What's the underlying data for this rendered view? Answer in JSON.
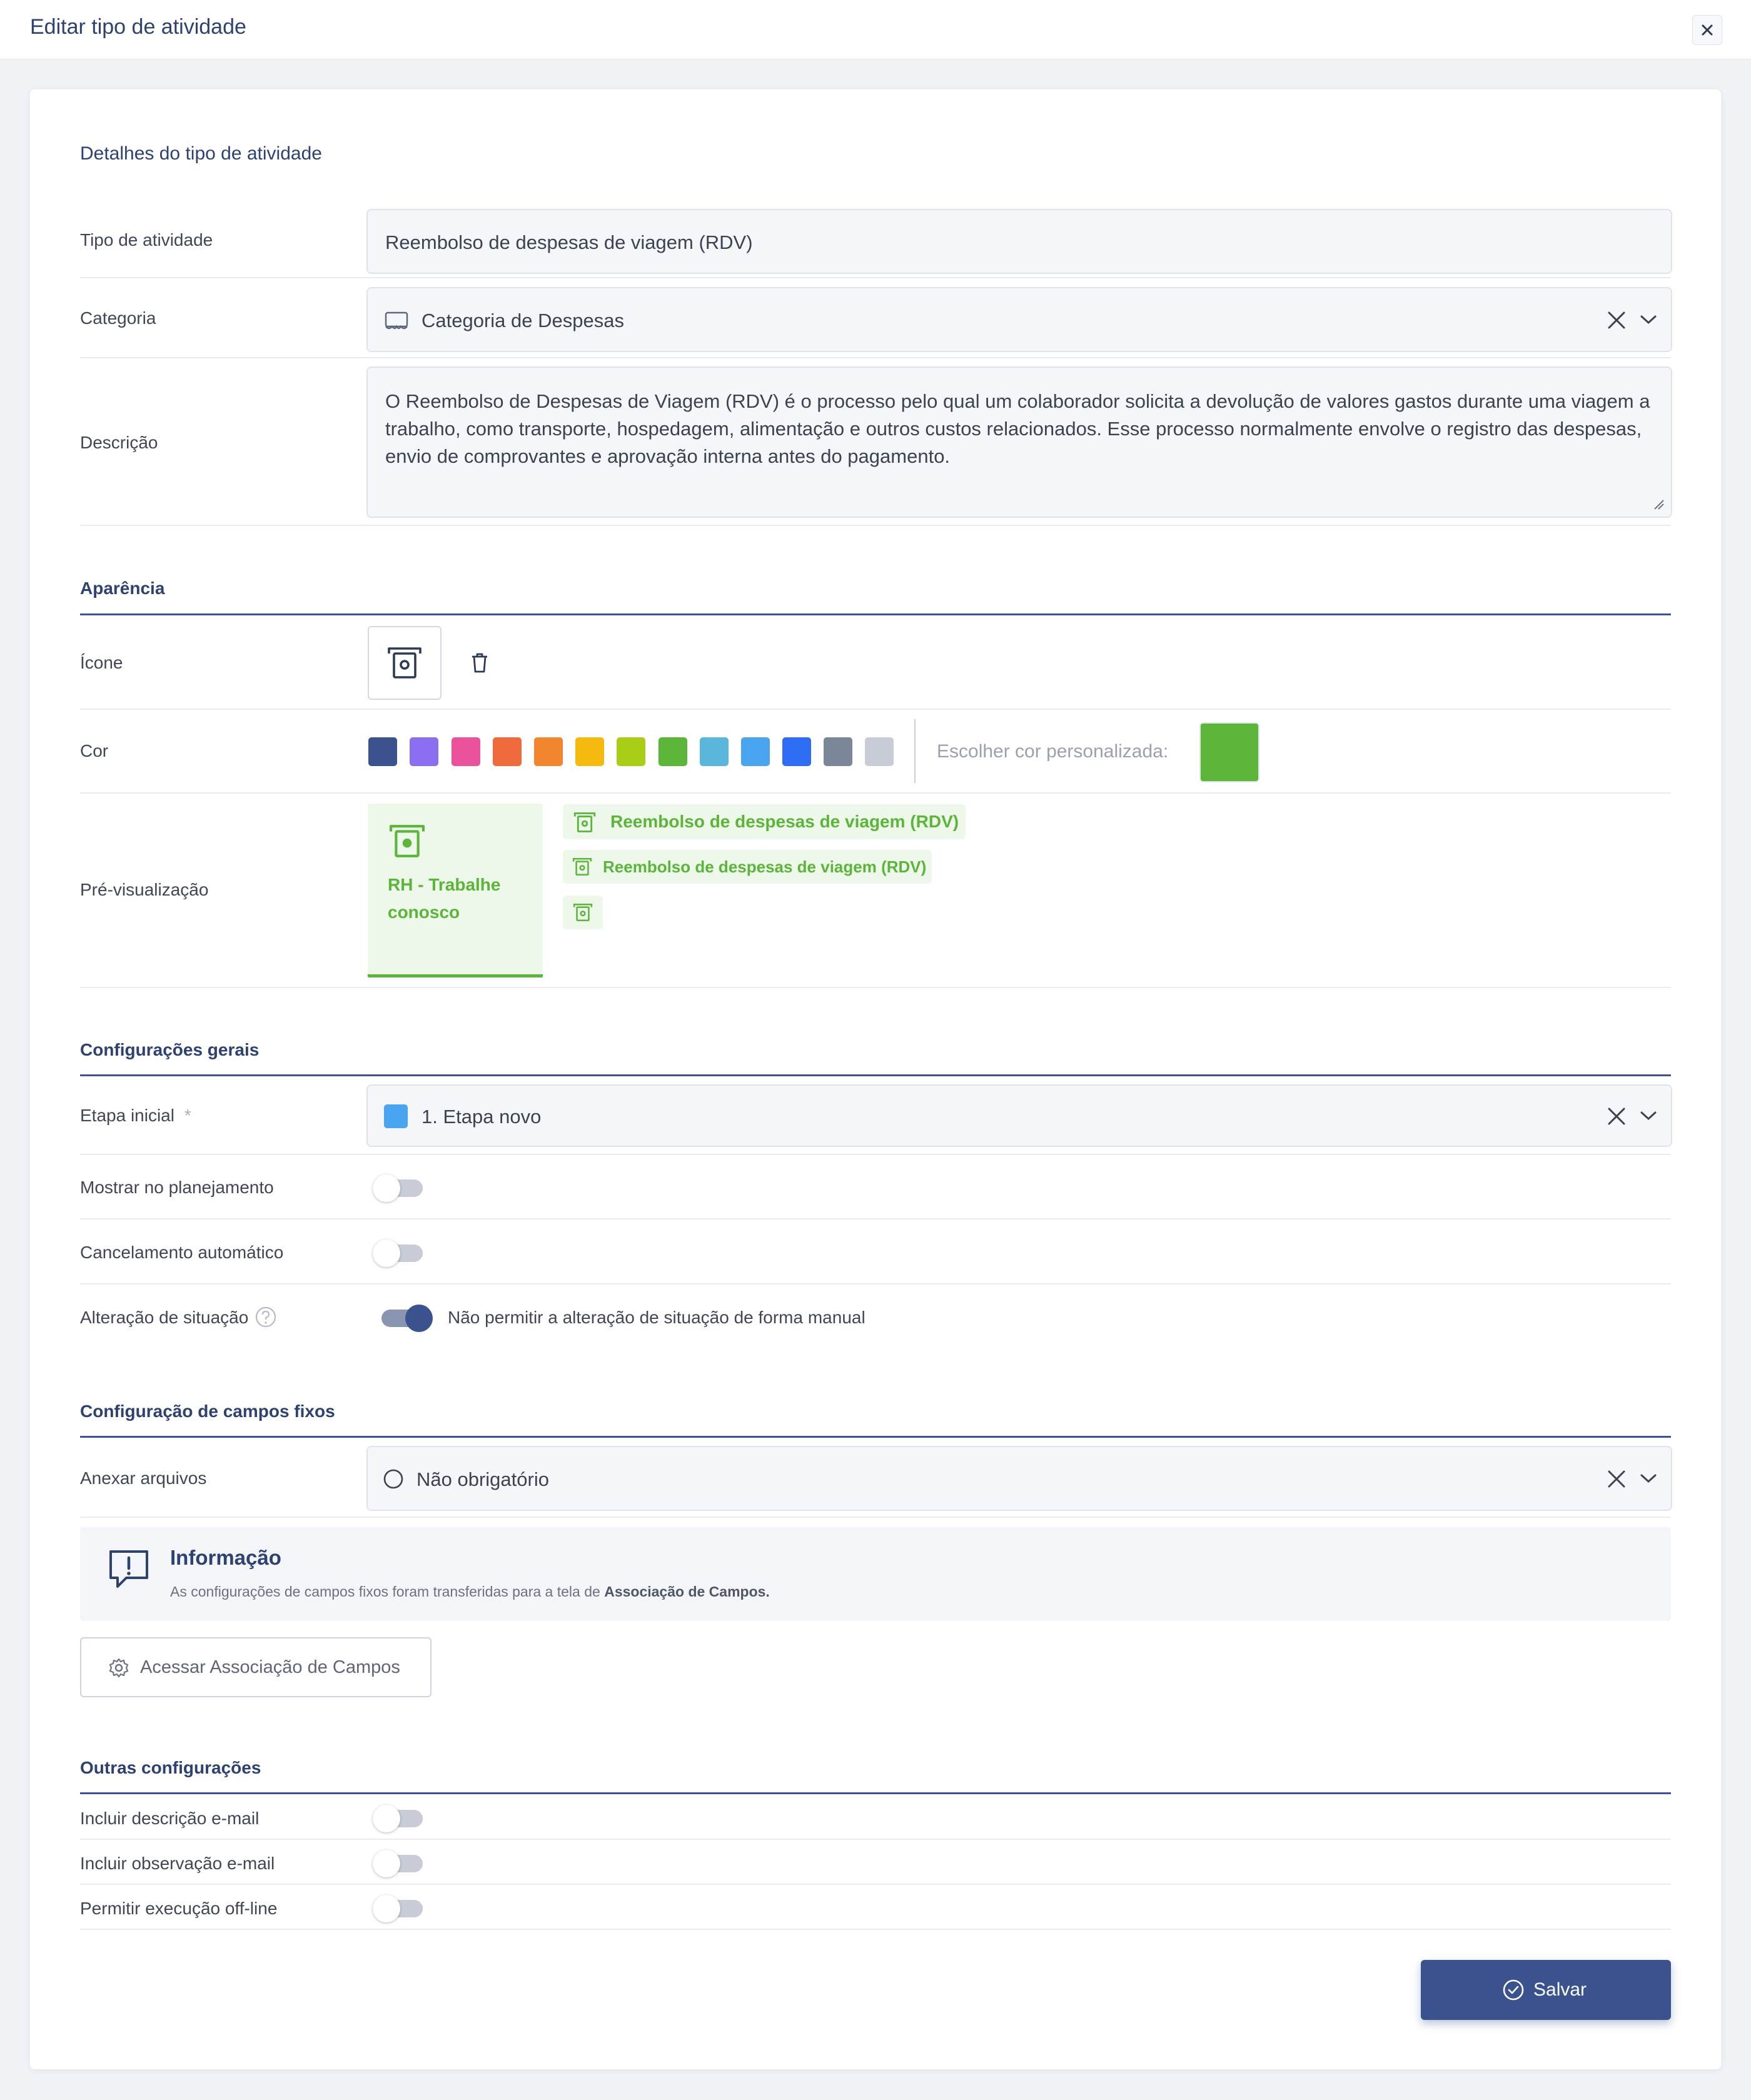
{
  "modal": {
    "title": "Editar tipo de atividade"
  },
  "details": {
    "section_title": "Detalhes do tipo de atividade",
    "activity_type_label": "Tipo de atividade",
    "activity_type_value": "Reembolso de despesas de viagem (RDV)",
    "category_label": "Categoria",
    "category_value": "Categoria de Despesas",
    "description_label": "Descrição",
    "description_value": "O Reembolso de Despesas de Viagem (RDV) é o processo pelo qual um colaborador solicita a devolução de valores gastos durante uma viagem a trabalho, como transporte, hospedagem, alimentação e outros custos relacionados. Esse processo normalmente envolve o registro das despesas, envio de comprovantes e aprovação interna antes do pagamento."
  },
  "appearance": {
    "section_title": "Aparência",
    "icon_label": "Ícone",
    "icon_name": "atm-cash-icon",
    "color_label": "Cor",
    "colors": [
      "#3a538f",
      "#8c6ff0",
      "#e9519a",
      "#ee6a3a",
      "#f2862e",
      "#f5b90f",
      "#a8cf15",
      "#5bb539",
      "#5ab6da",
      "#4aa5f0",
      "#2f6cf5",
      "#7c8699",
      "#c8ccd6"
    ],
    "custom_color_label": "Escolher cor personalizada:",
    "custom_color": "#5bb539",
    "preview_label": "Pré-visualização",
    "preview_card_text": "RH - Trabalhe conosco",
    "preview_chip_large": "Reembolso de despesas de viagem (RDV)",
    "preview_chip_small": "Reembolso de despesas de viagem (RDV)"
  },
  "general": {
    "section_title": "Configurações gerais",
    "initial_stage_label": "Etapa inicial",
    "required_mark": "*",
    "initial_stage_value": "1. Etapa novo",
    "initial_stage_color": "#4aa5f0",
    "show_planning_label": "Mostrar no planejamento",
    "show_planning_on": false,
    "auto_cancel_label": "Cancelamento automático",
    "auto_cancel_on": false,
    "status_change_label": "Alteração de situação",
    "status_change_on": true,
    "status_change_text": "Não permitir a alteração de situação de forma manual"
  },
  "fixed_fields": {
    "section_title": "Configuração de campos fixos",
    "attach_label": "Anexar arquivos",
    "attach_value": "Não obrigatório",
    "info_title": "Informação",
    "info_text": "As configurações de campos fixos foram transferidas para a tela de ",
    "info_text_bold": "Associação de Campos.",
    "access_button": "Acessar Associação de Campos"
  },
  "other": {
    "section_title": "Outras configurações",
    "include_desc_label": "Incluir descrição e-mail",
    "include_obs_label": "Incluir observação e-mail",
    "offline_label": "Permitir execução off-line"
  },
  "footer": {
    "save_button": "Salvar"
  }
}
